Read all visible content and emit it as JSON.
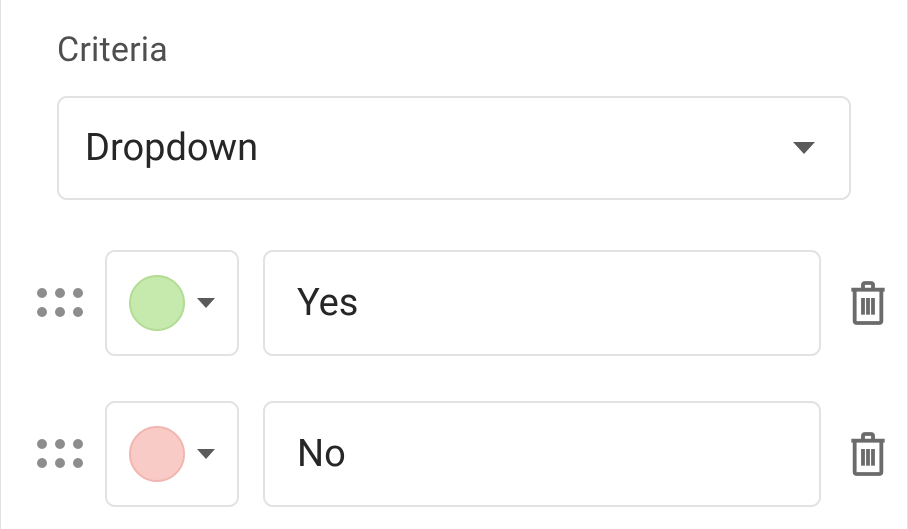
{
  "section": {
    "title": "Criteria"
  },
  "typeSelect": {
    "value": "Dropdown"
  },
  "options": [
    {
      "color": "green",
      "value": "Yes"
    },
    {
      "color": "red",
      "value": "No"
    }
  ]
}
